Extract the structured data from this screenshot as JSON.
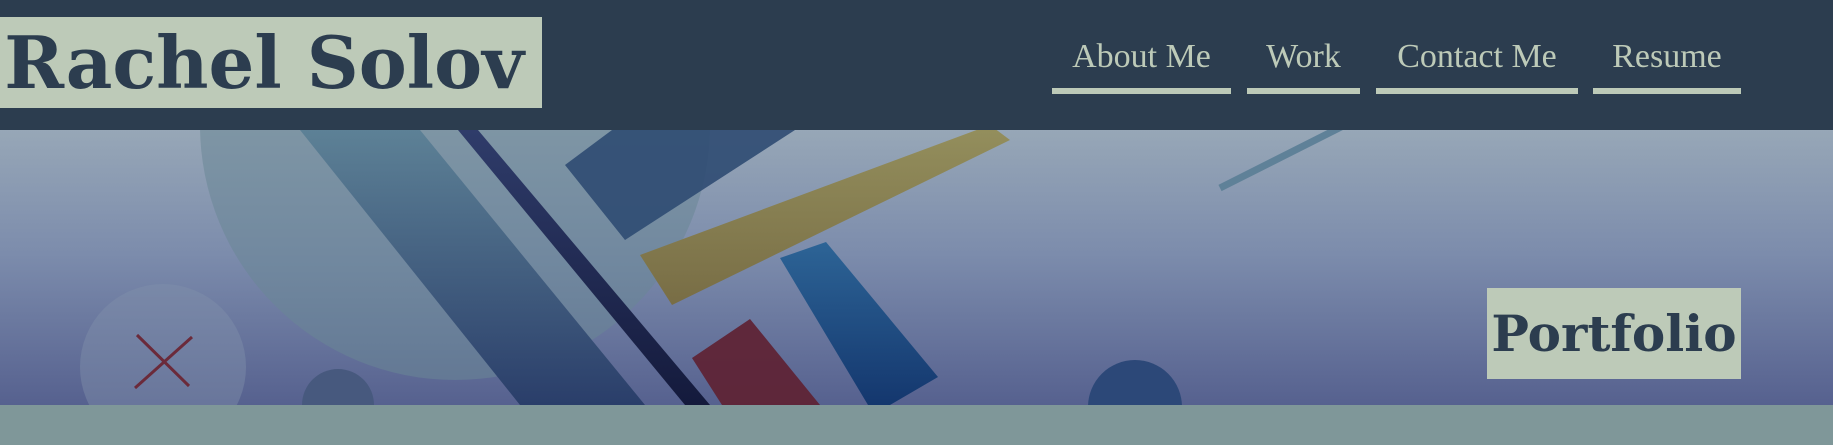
{
  "header": {
    "brand": "Rachel Solov",
    "nav": [
      {
        "label": "About Me"
      },
      {
        "label": "Work"
      },
      {
        "label": "Contact Me"
      },
      {
        "label": "Resume"
      }
    ]
  },
  "hero": {
    "badge": "Portfolio"
  },
  "colors": {
    "header_bg": "#2c3d4f",
    "accent_pale": "#bdcab8",
    "footer_strip": "#7f9799",
    "shape_yellow": "#8b8455",
    "shape_red": "#6b2436",
    "shape_blue": "#2a5a8e"
  }
}
